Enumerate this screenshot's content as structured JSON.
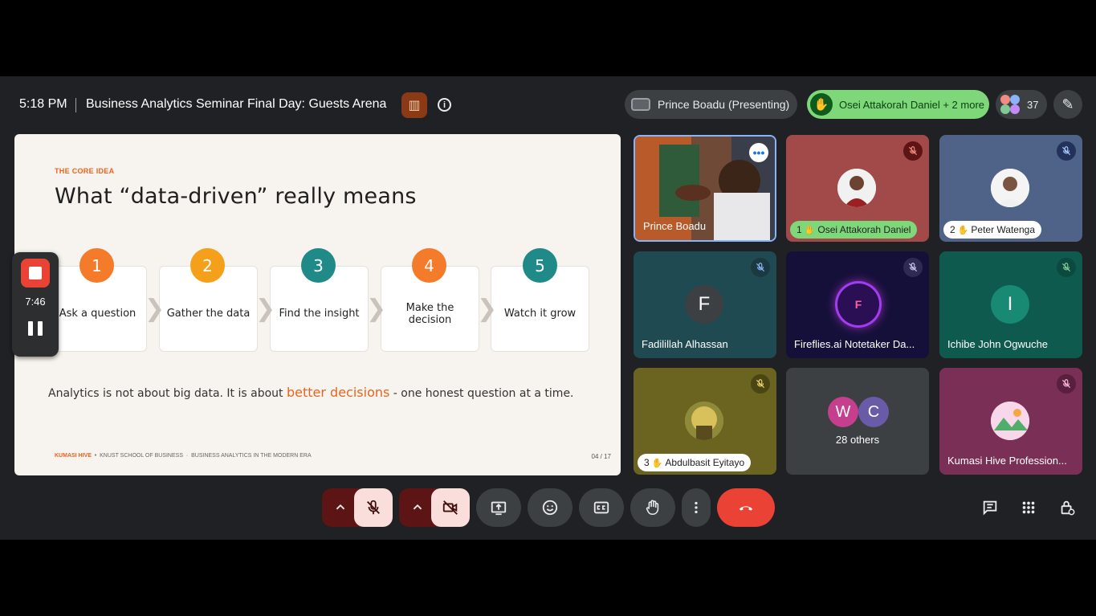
{
  "header": {
    "time": "5:18 PM",
    "meeting_title": "Business Analytics Seminar Final Day: Guests Arena",
    "presenter_label": "Prince Boadu (Presenting)",
    "hands_raised_label": "Osei Attakorah Daniel + 2 more",
    "participant_count": "37"
  },
  "slide": {
    "kicker": "THE CORE IDEA",
    "headline": "What “data-driven” really means",
    "steps": [
      {
        "num": "1",
        "label": "Ask a question",
        "color": "#f47b2a"
      },
      {
        "num": "2",
        "label": "Gather the data",
        "color": "#f5a01a"
      },
      {
        "num": "3",
        "label": "Find the insight",
        "color": "#1f8a87"
      },
      {
        "num": "4",
        "label": "Make the decision",
        "color": "#f47b2a"
      },
      {
        "num": "5",
        "label": "Watch it grow",
        "color": "#1f8a87"
      }
    ],
    "tagline_pre": "Analytics is not about big data. It is about ",
    "tagline_highlight": "better decisions",
    "tagline_post": " - one honest question at a time.",
    "footer_brand": "KUMASI HIVE",
    "footer_school": "KNUST SCHOOL OF BUSINESS",
    "footer_course": "BUSINESS ANALYTICS IN THE MODERN ERA",
    "page": "04 / 17"
  },
  "recording": {
    "elapsed": "7:46"
  },
  "tiles": [
    {
      "name": "Prince Boadu"
    },
    {
      "name": "Osei Attakorah Daniel",
      "hand_order": "1"
    },
    {
      "name": "Peter Watenga",
      "hand_order": "2"
    },
    {
      "name": "Fadilillah Alhassan",
      "initial": "F"
    },
    {
      "name": "Fireflies.ai Notetaker Da..."
    },
    {
      "name": "Ichibe John Ogwuche",
      "initial": "I"
    },
    {
      "name": "Abdulbasit Eyitayo",
      "hand_order": "3"
    },
    {
      "name": "28 others",
      "initials": [
        "W",
        "C"
      ]
    },
    {
      "name": "Kumasi Hive Profession..."
    }
  ],
  "icons": {
    "mic": "mic-off-icon",
    "camera": "camera-off-icon",
    "present": "present-screen-icon",
    "emoji": "emoji-icon",
    "captions": "captions-icon",
    "hand": "raise-hand-icon",
    "more": "more-vert-icon",
    "end": "end-call-icon",
    "chat": "chat-icon",
    "activities": "activities-icon",
    "host": "host-controls-icon"
  }
}
